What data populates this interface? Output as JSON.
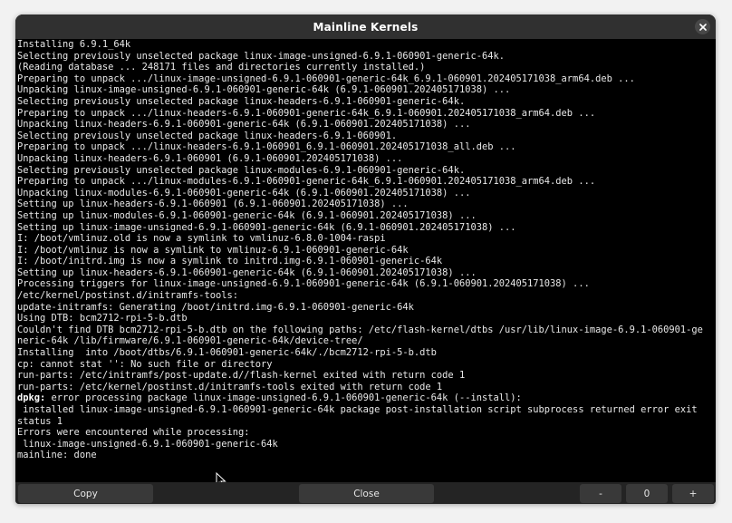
{
  "window": {
    "title": "Mainline Kernels"
  },
  "terminal": {
    "lines": [
      "Installing 6.9.1_64k",
      "Selecting previously unselected package linux-image-unsigned-6.9.1-060901-generic-64k.",
      "(Reading database ... 248171 files and directories currently installed.)",
      "Preparing to unpack .../linux-image-unsigned-6.9.1-060901-generic-64k_6.9.1-060901.202405171038_arm64.deb ...",
      "Unpacking linux-image-unsigned-6.9.1-060901-generic-64k (6.9.1-060901.202405171038) ...",
      "Selecting previously unselected package linux-headers-6.9.1-060901-generic-64k.",
      "Preparing to unpack .../linux-headers-6.9.1-060901-generic-64k_6.9.1-060901.202405171038_arm64.deb ...",
      "Unpacking linux-headers-6.9.1-060901-generic-64k (6.9.1-060901.202405171038) ...",
      "Selecting previously unselected package linux-headers-6.9.1-060901.",
      "Preparing to unpack .../linux-headers-6.9.1-060901_6.9.1-060901.202405171038_all.deb ...",
      "Unpacking linux-headers-6.9.1-060901 (6.9.1-060901.202405171038) ...",
      "Selecting previously unselected package linux-modules-6.9.1-060901-generic-64k.",
      "Preparing to unpack .../linux-modules-6.9.1-060901-generic-64k_6.9.1-060901.202405171038_arm64.deb ...",
      "Unpacking linux-modules-6.9.1-060901-generic-64k (6.9.1-060901.202405171038) ...",
      "Setting up linux-headers-6.9.1-060901 (6.9.1-060901.202405171038) ...",
      "Setting up linux-modules-6.9.1-060901-generic-64k (6.9.1-060901.202405171038) ...",
      "Setting up linux-image-unsigned-6.9.1-060901-generic-64k (6.9.1-060901.202405171038) ...",
      "I: /boot/vmlinuz.old is now a symlink to vmlinuz-6.8.0-1004-raspi",
      "I: /boot/vmlinuz is now a symlink to vmlinuz-6.9.1-060901-generic-64k",
      "I: /boot/initrd.img is now a symlink to initrd.img-6.9.1-060901-generic-64k",
      "Setting up linux-headers-6.9.1-060901-generic-64k (6.9.1-060901.202405171038) ...",
      "Processing triggers for linux-image-unsigned-6.9.1-060901-generic-64k (6.9.1-060901.202405171038) ...",
      "/etc/kernel/postinst.d/initramfs-tools:",
      "update-initramfs: Generating /boot/initrd.img-6.9.1-060901-generic-64k",
      "Using DTB: bcm2712-rpi-5-b.dtb",
      "Couldn't find DTB bcm2712-rpi-5-b.dtb on the following paths: /etc/flash-kernel/dtbs /usr/lib/linux-image-6.9.1-060901-ge",
      "neric-64k /lib/firmware/6.9.1-060901-generic-64k/device-tree/",
      "Installing  into /boot/dtbs/6.9.1-060901-generic-64k/./bcm2712-rpi-5-b.dtb",
      "cp: cannot stat '': No such file or directory",
      "run-parts: /etc/initramfs/post-update.d//flash-kernel exited with return code 1",
      "run-parts: /etc/kernel/postinst.d/initramfs-tools exited with return code 1",
      "dpkg: error processing package linux-image-unsigned-6.9.1-060901-generic-64k (--install):",
      " installed linux-image-unsigned-6.9.1-060901-generic-64k package post-installation script subprocess returned error exit",
      "status 1",
      "Errors were encountered while processing:",
      " linux-image-unsigned-6.9.1-060901-generic-64k",
      "mainline: done",
      "",
      "_"
    ],
    "dpkg_prefix": "dpkg:",
    "dpkg_line_index": 31
  },
  "buttons": {
    "copy": "Copy",
    "close": "Close",
    "minus": "-",
    "zoom_value": "0",
    "plus": "+"
  },
  "icons": {
    "close": "close-icon",
    "pointer": "mouse-pointer-icon"
  }
}
